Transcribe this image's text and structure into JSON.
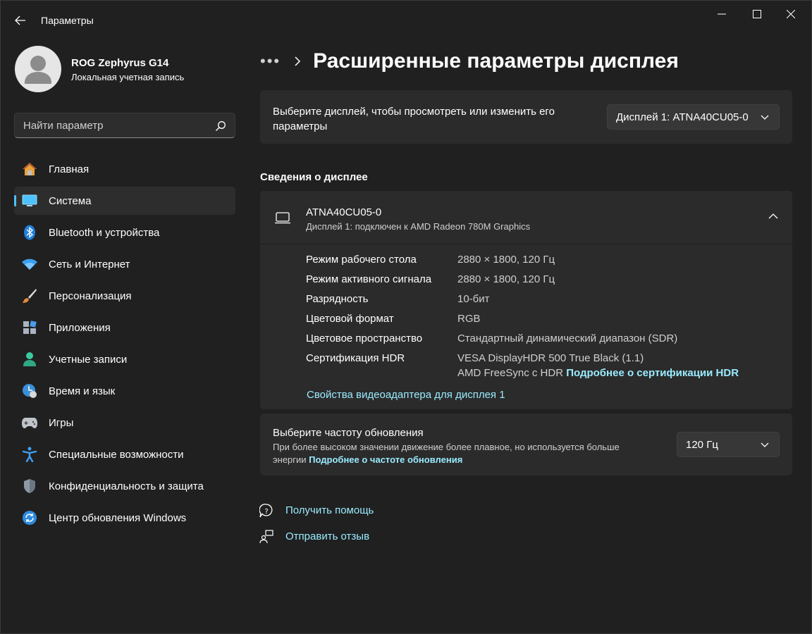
{
  "window": {
    "app_title": "Параметры"
  },
  "profile": {
    "name": "ROG Zephyrus G14",
    "account_type": "Локальная учетная запись"
  },
  "search": {
    "placeholder": "Найти параметр"
  },
  "sidebar": {
    "items": [
      {
        "label": "Главная",
        "icon": "home-icon"
      },
      {
        "label": "Система",
        "icon": "system-monitor-icon",
        "active": true
      },
      {
        "label": "Bluetooth и устройства",
        "icon": "bluetooth-icon"
      },
      {
        "label": "Сеть и Интернет",
        "icon": "wifi-icon"
      },
      {
        "label": "Персонализация",
        "icon": "brush-icon"
      },
      {
        "label": "Приложения",
        "icon": "apps-icon"
      },
      {
        "label": "Учетные записи",
        "icon": "account-icon"
      },
      {
        "label": "Время и язык",
        "icon": "time-language-icon"
      },
      {
        "label": "Игры",
        "icon": "gamepad-icon"
      },
      {
        "label": "Специальные возможности",
        "icon": "accessibility-icon"
      },
      {
        "label": "Конфиденциальность и защита",
        "icon": "shield-icon"
      },
      {
        "label": "Центр обновления Windows",
        "icon": "update-icon"
      }
    ]
  },
  "header": {
    "more": "•••",
    "title": "Расширенные параметры дисплея"
  },
  "display_select": {
    "label": "Выберите дисплей, чтобы просмотреть или изменить его параметры",
    "selected": "Дисплей 1: ATNA40CU05-0"
  },
  "display_info": {
    "section_title": "Сведения о дисплее",
    "name": "ATNA40CU05-0",
    "subtitle": "Дисплей 1: подключен к AMD Radeon 780M Graphics",
    "rows": [
      {
        "label": "Режим рабочего стола",
        "value": "2880 × 1800, 120 Гц"
      },
      {
        "label": "Режим активного сигнала",
        "value": "2880 × 1800, 120 Гц"
      },
      {
        "label": "Разрядность",
        "value": "10-бит"
      },
      {
        "label": "Цветовой формат",
        "value": "RGB"
      },
      {
        "label": "Цветовое пространство",
        "value": "Стандартный динамический диапазон (SDR)"
      },
      {
        "label": "Сертификация HDR",
        "value": "VESA DisplayHDR 500 True Black (1.1)"
      }
    ],
    "hdr_line2": "AMD FreeSync с HDR",
    "hdr_link": "Подробнее о сертификации HDR",
    "adapter_link": "Свойства видеоадаптера для дисплея 1"
  },
  "refresh": {
    "title": "Выберите частоту обновления",
    "description": "При более высоком значении движение более плавное, но используется больше энергии",
    "link": "Подробнее о частоте обновления",
    "selected": "120 Гц"
  },
  "footer": {
    "help": "Получить помощь",
    "feedback": "Отправить отзыв"
  },
  "colors": {
    "background": "#202020",
    "card": "#2b2b2b",
    "accent": "#4cc2ff",
    "link": "#99ebff"
  }
}
